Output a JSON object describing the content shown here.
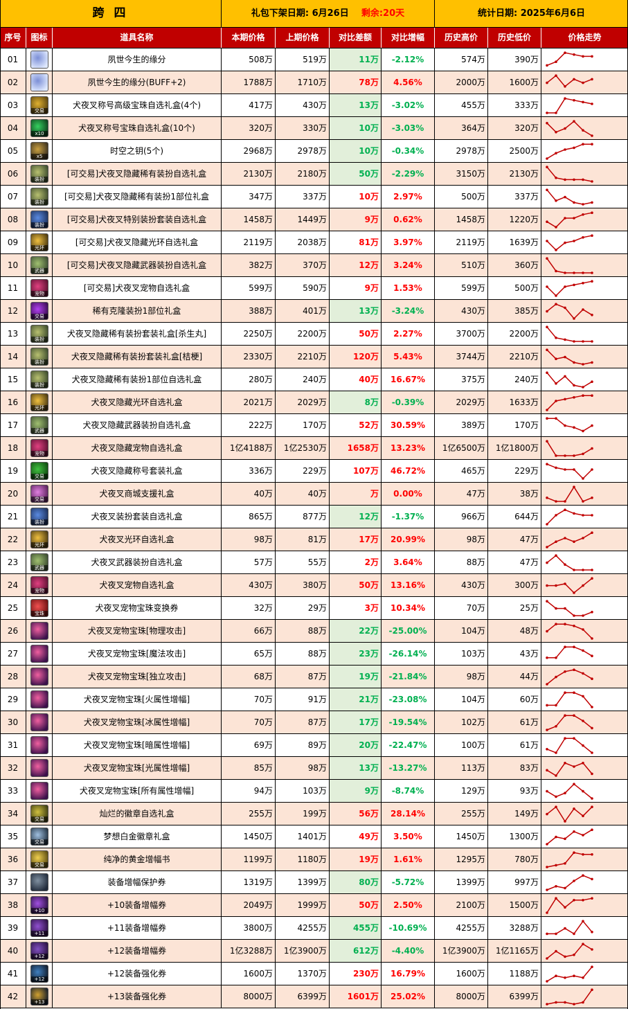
{
  "header": {
    "region": "跨 四",
    "offline_label": "礼包下架日期:",
    "offline_date": "6月26日",
    "remaining_label": "剩余:",
    "remaining_value": "20天",
    "stat_label": "统计日期:",
    "stat_date": "2025年6月6日"
  },
  "columns": [
    "序号",
    "图标",
    "道具名称",
    "本期价格",
    "上期价格",
    "对比差额",
    "对比增幅",
    "历史高价",
    "历史低价",
    "价格走势"
  ],
  "colors": {
    "header_bg": "#ffc000",
    "col_header_bg": "#c00000",
    "alt_row": "#fce4d6",
    "up": "#ff0000",
    "down": "#00b050",
    "trend": "#c00000"
  },
  "rows": [
    {
      "no": "01",
      "icon": "bubble-icon",
      "name": "夙世今生的缘分",
      "cur": "508万",
      "prev": "519万",
      "diff": "11万",
      "pct": "-2.12%",
      "hi": "574万",
      "lo": "390万",
      "dir": "down",
      "trend": [
        2,
        4,
        9,
        8,
        7,
        7
      ]
    },
    {
      "no": "02",
      "icon": "bubble-icon",
      "name": "夙世今生的缘分(BUFF+2)",
      "cur": "1788万",
      "prev": "1710万",
      "diff": "78万",
      "pct": "4.56%",
      "hi": "2000万",
      "lo": "1600万",
      "dir": "up",
      "trend": [
        5,
        9,
        3,
        7,
        5,
        7
      ]
    },
    {
      "no": "03",
      "icon": "gold-box-icon",
      "name": "犬夜叉称号高级宝珠自选礼盒(4个)",
      "cur": "417万",
      "prev": "430万",
      "diff": "13万",
      "pct": "-3.02%",
      "hi": "455万",
      "lo": "333万",
      "dir": "down",
      "trend": [
        1,
        1,
        9,
        8,
        7,
        6
      ]
    },
    {
      "no": "04",
      "icon": "green-orb-icon",
      "name": "犬夜叉称号宝珠自选礼盒(10个)",
      "cur": "320万",
      "prev": "330万",
      "diff": "10万",
      "pct": "-3.03%",
      "hi": "364万",
      "lo": "320万",
      "dir": "down",
      "trend": [
        8,
        3,
        5,
        9,
        4,
        1
      ]
    },
    {
      "no": "05",
      "icon": "key-icon",
      "name": "时空之钥(5个)",
      "cur": "2968万",
      "prev": "2978万",
      "diff": "10万",
      "pct": "-0.34%",
      "hi": "2978万",
      "lo": "2500万",
      "dir": "down",
      "trend": [
        1,
        4,
        6,
        7,
        9,
        9
      ]
    },
    {
      "no": "06",
      "icon": "costume-box-icon",
      "name": "[可交易]犬夜叉隐藏稀有装扮自选礼盒",
      "cur": "2130万",
      "prev": "2180万",
      "diff": "50万",
      "pct": "-2.29%",
      "hi": "3150万",
      "lo": "2130万",
      "dir": "down",
      "trend": [
        9,
        3,
        2,
        2,
        2,
        1
      ]
    },
    {
      "no": "07",
      "icon": "costume-box-icon",
      "name": "[可交易]犬夜叉隐藏稀有装扮1部位礼盒",
      "cur": "347万",
      "prev": "337万",
      "diff": "10万",
      "pct": "2.97%",
      "hi": "500万",
      "lo": "337万",
      "dir": "up",
      "trend": [
        9,
        3,
        5,
        2,
        1,
        2
      ]
    },
    {
      "no": "08",
      "icon": "blue-box-icon",
      "name": "[可交易]犬夜叉特别装扮套装自选礼盒",
      "cur": "1458万",
      "prev": "1449万",
      "diff": "9万",
      "pct": "0.62%",
      "hi": "1458万",
      "lo": "1220万",
      "dir": "up",
      "trend": [
        4,
        1,
        6,
        6,
        8,
        9
      ]
    },
    {
      "no": "09",
      "icon": "aura-box-icon",
      "name": "[可交易]犬夜叉隐藏光环自选礼盒",
      "cur": "2119万",
      "prev": "2038万",
      "diff": "81万",
      "pct": "3.97%",
      "hi": "2119万",
      "lo": "1639万",
      "dir": "up",
      "trend": [
        6,
        1,
        5,
        6,
        8,
        9
      ]
    },
    {
      "no": "10",
      "icon": "weapon-box-icon",
      "name": "[可交易]犬夜叉隐藏武器装扮自选礼盒",
      "cur": "382万",
      "prev": "370万",
      "diff": "12万",
      "pct": "3.24%",
      "hi": "510万",
      "lo": "360万",
      "dir": "up",
      "trend": [
        9,
        2,
        1,
        1,
        1,
        1
      ]
    },
    {
      "no": "11",
      "icon": "pet-box-icon",
      "name": "[可交易]犬夜叉宠物自选礼盒",
      "cur": "599万",
      "prev": "590万",
      "diff": "9万",
      "pct": "1.53%",
      "hi": "599万",
      "lo": "500万",
      "dir": "up",
      "trend": [
        6,
        1,
        6,
        7,
        8,
        9
      ]
    },
    {
      "no": "12",
      "icon": "purple-orb-icon",
      "name": "稀有克隆装扮1部位礼盒",
      "cur": "388万",
      "prev": "401万",
      "diff": "13万",
      "pct": "-3.24%",
      "hi": "430万",
      "lo": "385万",
      "dir": "down",
      "trend": [
        5,
        9,
        7,
        1,
        6,
        3
      ]
    },
    {
      "no": "13",
      "icon": "costume-box-icon",
      "name": "犬夜叉隐藏稀有装扮套装礼盒[杀生丸]",
      "cur": "2250万",
      "prev": "2200万",
      "diff": "50万",
      "pct": "2.27%",
      "hi": "3700万",
      "lo": "2200万",
      "dir": "up",
      "trend": [
        9,
        3,
        2,
        1,
        1,
        1
      ]
    },
    {
      "no": "14",
      "icon": "costume-box-icon",
      "name": "犬夜叉隐藏稀有装扮套装礼盒[桔梗]",
      "cur": "2330万",
      "prev": "2210万",
      "diff": "120万",
      "pct": "5.43%",
      "hi": "3744万",
      "lo": "2210万",
      "dir": "up",
      "trend": [
        9,
        4,
        5,
        2,
        1,
        2
      ]
    },
    {
      "no": "15",
      "icon": "costume-box-icon",
      "name": "犬夜叉隐藏稀有装扮1部位自选礼盒",
      "cur": "280万",
      "prev": "240万",
      "diff": "40万",
      "pct": "16.67%",
      "hi": "375万",
      "lo": "240万",
      "dir": "up",
      "trend": [
        9,
        3,
        7,
        2,
        1,
        4
      ]
    },
    {
      "no": "16",
      "icon": "aura-box-icon",
      "name": "犬夜叉隐藏光环自选礼盒",
      "cur": "2021万",
      "prev": "2029万",
      "diff": "8万",
      "pct": "-0.39%",
      "hi": "2029万",
      "lo": "1633万",
      "dir": "down",
      "trend": [
        1,
        6,
        7,
        8,
        9,
        9
      ]
    },
    {
      "no": "17",
      "icon": "weapon-box-icon",
      "name": "犬夜叉隐藏武器装扮自选礼盒",
      "cur": "222万",
      "prev": "170万",
      "diff": "52万",
      "pct": "30.59%",
      "hi": "389万",
      "lo": "170万",
      "dir": "up",
      "trend": [
        9,
        9,
        5,
        4,
        2,
        5
      ]
    },
    {
      "no": "18",
      "icon": "pet-box-icon",
      "name": "犬夜叉隐藏宠物自选礼盒",
      "cur": "1亿4188万",
      "prev": "1亿2530万",
      "diff": "1658万",
      "pct": "13.23%",
      "hi": "1亿6500万",
      "lo": "1亿1800万",
      "dir": "up",
      "trend": [
        9,
        1,
        1,
        1,
        2,
        5
      ]
    },
    {
      "no": "19",
      "icon": "title-box-icon",
      "name": "犬夜叉隐藏称号套装礼盒",
      "cur": "336万",
      "prev": "229万",
      "diff": "107万",
      "pct": "46.72%",
      "hi": "465万",
      "lo": "229万",
      "dir": "up",
      "trend": [
        9,
        7,
        6,
        6,
        1,
        6
      ]
    },
    {
      "no": "20",
      "icon": "support-box-icon",
      "name": "犬夜叉商城支援礼盒",
      "cur": "40万",
      "prev": "40万",
      "diff": "万",
      "pct": "0.00%",
      "hi": "47万",
      "lo": "38万",
      "dir": "up",
      "trend": [
        3,
        1,
        1,
        9,
        1,
        3
      ]
    },
    {
      "no": "21",
      "icon": "blue-box-icon",
      "name": "犬夜叉装扮套装自选礼盒",
      "cur": "865万",
      "prev": "877万",
      "diff": "12万",
      "pct": "-1.37%",
      "hi": "966万",
      "lo": "644万",
      "dir": "down",
      "trend": [
        1,
        6,
        9,
        7,
        6,
        6
      ]
    },
    {
      "no": "22",
      "icon": "aura-box-icon",
      "name": "犬夜叉光环自选礼盒",
      "cur": "98万",
      "prev": "81万",
      "diff": "17万",
      "pct": "20.99%",
      "hi": "98万",
      "lo": "47万",
      "dir": "up",
      "trend": [
        1,
        4,
        6,
        4,
        6,
        9
      ]
    },
    {
      "no": "23",
      "icon": "weapon-box-icon",
      "name": "犬夜叉武器装扮自选礼盒",
      "cur": "57万",
      "prev": "55万",
      "diff": "2万",
      "pct": "3.64%",
      "hi": "88万",
      "lo": "47万",
      "dir": "up",
      "trend": [
        5,
        9,
        4,
        1,
        1,
        1
      ]
    },
    {
      "no": "24",
      "icon": "pet-box-icon",
      "name": "犬夜叉宠物自选礼盒",
      "cur": "430万",
      "prev": "380万",
      "diff": "50万",
      "pct": "13.16%",
      "hi": "430万",
      "lo": "300万",
      "dir": "up",
      "trend": [
        5,
        5,
        6,
        1,
        5,
        9
      ]
    },
    {
      "no": "25",
      "icon": "pet-orb-box-icon",
      "name": "犬夜叉宠物宝珠变换券",
      "cur": "32万",
      "prev": "29万",
      "diff": "3万",
      "pct": "10.34%",
      "hi": "70万",
      "lo": "25万",
      "dir": "up",
      "trend": [
        9,
        5,
        5,
        1,
        1,
        3
      ]
    },
    {
      "no": "26",
      "icon": "pet-orb-icon",
      "name": "犬夜叉宠物宝珠[物理攻击]",
      "cur": "66万",
      "prev": "88万",
      "diff": "22万",
      "pct": "-25.00%",
      "hi": "104万",
      "lo": "48万",
      "dir": "down",
      "trend": [
        5,
        9,
        9,
        8,
        6,
        1
      ]
    },
    {
      "no": "27",
      "icon": "pet-orb-icon",
      "name": "犬夜叉宠物宝珠[魔法攻击]",
      "cur": "65万",
      "prev": "88万",
      "diff": "23万",
      "pct": "-26.14%",
      "hi": "103万",
      "lo": "43万",
      "dir": "down",
      "trend": [
        3,
        3,
        9,
        9,
        7,
        4
      ]
    },
    {
      "no": "28",
      "icon": "pet-orb-icon",
      "name": "犬夜叉宠物宝珠[独立攻击]",
      "cur": "68万",
      "prev": "87万",
      "diff": "19万",
      "pct": "-21.84%",
      "hi": "98万",
      "lo": "44万",
      "dir": "down",
      "trend": [
        1,
        5,
        8,
        9,
        7,
        4
      ]
    },
    {
      "no": "29",
      "icon": "pet-orb-icon",
      "name": "犬夜叉宠物宝珠[火属性增幅]",
      "cur": "70万",
      "prev": "91万",
      "diff": "21万",
      "pct": "-23.08%",
      "hi": "104万",
      "lo": "60万",
      "dir": "down",
      "trend": [
        2,
        2,
        9,
        9,
        7,
        1
      ]
    },
    {
      "no": "30",
      "icon": "pet-orb-icon",
      "name": "犬夜叉宠物宝珠[冰属性增幅]",
      "cur": "70万",
      "prev": "87万",
      "diff": "17万",
      "pct": "-19.54%",
      "hi": "102万",
      "lo": "61万",
      "dir": "down",
      "trend": [
        1,
        3,
        9,
        9,
        6,
        2
      ]
    },
    {
      "no": "31",
      "icon": "pet-orb-icon",
      "name": "犬夜叉宠物宝珠[暗属性增幅]",
      "cur": "69万",
      "prev": "89万",
      "diff": "20万",
      "pct": "-22.47%",
      "hi": "100万",
      "lo": "61万",
      "dir": "down",
      "trend": [
        3,
        1,
        9,
        9,
        5,
        1
      ]
    },
    {
      "no": "32",
      "icon": "pet-orb-icon",
      "name": "犬夜叉宠物宝珠[光属性增幅]",
      "cur": "85万",
      "prev": "98万",
      "diff": "13万",
      "pct": "-13.27%",
      "hi": "113万",
      "lo": "83万",
      "dir": "down",
      "trend": [
        4,
        1,
        8,
        6,
        8,
        2
      ]
    },
    {
      "no": "33",
      "icon": "pet-orb-icon",
      "name": "犬夜叉宠物宝珠[所有属性增幅]",
      "cur": "94万",
      "prev": "103万",
      "diff": "9万",
      "pct": "-8.74%",
      "hi": "129万",
      "lo": "93万",
      "dir": "down",
      "trend": [
        5,
        2,
        4,
        9,
        5,
        1
      ]
    },
    {
      "no": "34",
      "icon": "emblem-box-icon",
      "name": "灿烂的徽章自选礼盒",
      "cur": "255万",
      "prev": "199万",
      "diff": "56万",
      "pct": "28.14%",
      "hi": "255万",
      "lo": "149万",
      "dir": "up",
      "trend": [
        5,
        9,
        1,
        8,
        4,
        9
      ]
    },
    {
      "no": "35",
      "icon": "platinum-box-icon",
      "name": "梦想白金徽章礼盒",
      "cur": "1450万",
      "prev": "1401万",
      "diff": "49万",
      "pct": "3.50%",
      "hi": "1450万",
      "lo": "1300万",
      "dir": "up",
      "trend": [
        1,
        5,
        4,
        8,
        6,
        9
      ]
    },
    {
      "no": "36",
      "icon": "gold-scroll-icon",
      "name": "纯净的黄金增幅书",
      "cur": "1199万",
      "prev": "1180万",
      "diff": "19万",
      "pct": "1.61%",
      "hi": "1295万",
      "lo": "780万",
      "dir": "up",
      "trend": [
        1,
        2,
        3,
        9,
        8,
        8
      ]
    },
    {
      "no": "37",
      "icon": "protect-ticket-icon",
      "name": "装备增幅保护券",
      "cur": "1319万",
      "prev": "1399万",
      "diff": "80万",
      "pct": "-5.72%",
      "hi": "1399万",
      "lo": "997万",
      "dir": "down",
      "trend": [
        1,
        3,
        2,
        6,
        9,
        7
      ]
    },
    {
      "no": "38",
      "icon": "amp10-icon",
      "name": "+10装备增幅券",
      "cur": "2049万",
      "prev": "1999万",
      "diff": "50万",
      "pct": "2.50%",
      "hi": "2100万",
      "lo": "1500万",
      "dir": "up",
      "trend": [
        1,
        9,
        4,
        8,
        8,
        9
      ]
    },
    {
      "no": "39",
      "icon": "amp11-icon",
      "name": "+11装备增幅券",
      "cur": "3800万",
      "prev": "4255万",
      "diff": "455万",
      "pct": "-10.69%",
      "hi": "4255万",
      "lo": "3288万",
      "dir": "down",
      "trend": [
        2,
        2,
        5,
        2,
        9,
        3
      ]
    },
    {
      "no": "40",
      "icon": "amp12-icon",
      "name": "+12装备增幅券",
      "cur": "1亿3288万",
      "prev": "1亿3900万",
      "diff": "612万",
      "pct": "-4.40%",
      "hi": "1亿3900万",
      "lo": "1亿1165万",
      "dir": "down",
      "trend": [
        1,
        5,
        2,
        3,
        9,
        6
      ]
    },
    {
      "no": "41",
      "icon": "refine12-icon",
      "name": "+12装备强化券",
      "cur": "1600万",
      "prev": "1370万",
      "diff": "230万",
      "pct": "16.79%",
      "hi": "1600万",
      "lo": "1188万",
      "dir": "up",
      "trend": [
        1,
        4,
        3,
        4,
        3,
        9
      ]
    },
    {
      "no": "42",
      "icon": "refine13-icon",
      "name": "+13装备强化券",
      "cur": "8000万",
      "prev": "6399万",
      "diff": "1601万",
      "pct": "25.02%",
      "hi": "8000万",
      "lo": "6399万",
      "dir": "up",
      "trend": [
        1,
        2,
        2,
        1,
        2,
        9
      ]
    }
  ]
}
